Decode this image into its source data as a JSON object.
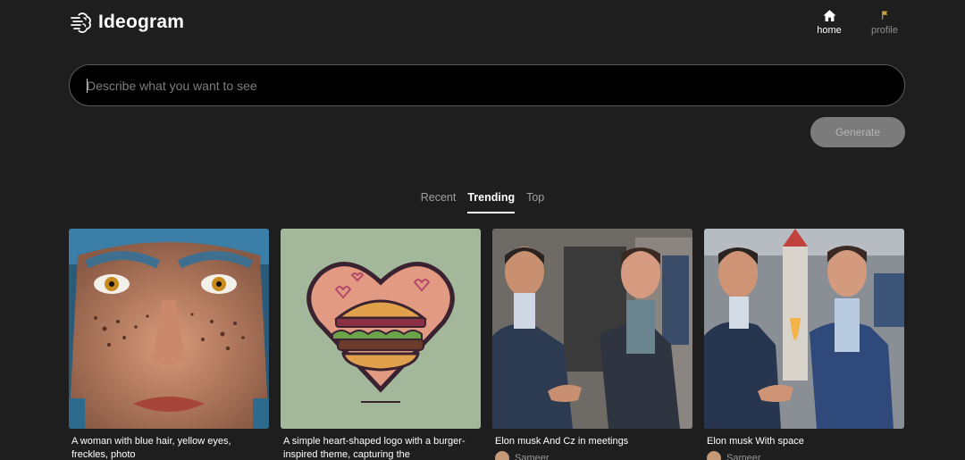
{
  "app": {
    "name": "Ideogram"
  },
  "nav": [
    {
      "label": "home",
      "icon": "home-icon"
    },
    {
      "label": "profile",
      "icon": "flag-icon"
    }
  ],
  "search": {
    "placeholder": "Describe what you want to see",
    "value": ""
  },
  "generate": {
    "label": "Generate"
  },
  "tabs": [
    {
      "label": "Recent",
      "active": false
    },
    {
      "label": "Trending",
      "active": true
    },
    {
      "label": "Top",
      "active": false
    }
  ],
  "cards": [
    {
      "caption": "A woman with blue hair, yellow eyes, freckles, photo",
      "author": ""
    },
    {
      "caption": "A simple heart-shaped logo with a burger-inspired theme, capturing the",
      "author": ""
    },
    {
      "caption": "Elon musk And Cz in meetings",
      "author": "Sameer"
    },
    {
      "caption": "Elon musk With space",
      "author": "Sameer"
    }
  ],
  "colors": {
    "background": "#1e1e1e",
    "accent": "#ffffff",
    "button_disabled": "#7b7b7b"
  }
}
